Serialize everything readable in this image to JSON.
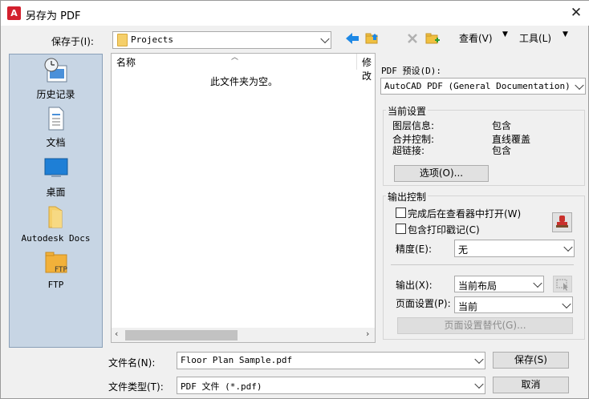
{
  "window": {
    "title": "另存为 PDF",
    "app_icon_letter": "A"
  },
  "toolbar": {
    "save_in_label": "保存于(I):",
    "location": "Projects",
    "view_label": "查看(V)",
    "tools_label": "工具(L)"
  },
  "places": [
    {
      "label": "历史记录",
      "icon": "history-icon"
    },
    {
      "label": "文档",
      "icon": "document-icon"
    },
    {
      "label": "桌面",
      "icon": "desktop-icon"
    },
    {
      "label": "Autodesk Docs",
      "icon": "folder-icon"
    },
    {
      "label": "FTP",
      "icon": "ftp-folder-icon"
    }
  ],
  "file_list": {
    "col_name": "名称",
    "col_modified": "修改",
    "empty_message": "此文件夹为空。"
  },
  "pdf_settings": {
    "preset_label": "PDF 预设(D):",
    "preset_value": "AutoCAD PDF (General Documentation)",
    "current_settings_title": "当前设置",
    "rows": [
      {
        "key": "图层信息:",
        "value": "包含"
      },
      {
        "key": "合并控制:",
        "value": "直线覆盖"
      },
      {
        "key": "超链接:",
        "value": "包含"
      }
    ],
    "options_button": "选项(O)...",
    "output_control_title": "输出控制",
    "open_in_viewer_label": "完成后在查看器中打开(W)",
    "include_stamp_label": "包含打印戳记(C)",
    "precision_label": "精度(E):",
    "precision_value": "无",
    "output_label": "输出(X):",
    "output_value": "当前布局",
    "page_setup_label": "页面设置(P):",
    "page_setup_value": "当前",
    "page_setup_override_button": "页面设置替代(G)..."
  },
  "footer": {
    "filename_label": "文件名(N):",
    "filename_value": "Floor Plan Sample.pdf",
    "filetype_label": "文件类型(T):",
    "filetype_value": "PDF 文件 (*.pdf)",
    "save_button": "保存(S)",
    "cancel_button": "取消"
  }
}
